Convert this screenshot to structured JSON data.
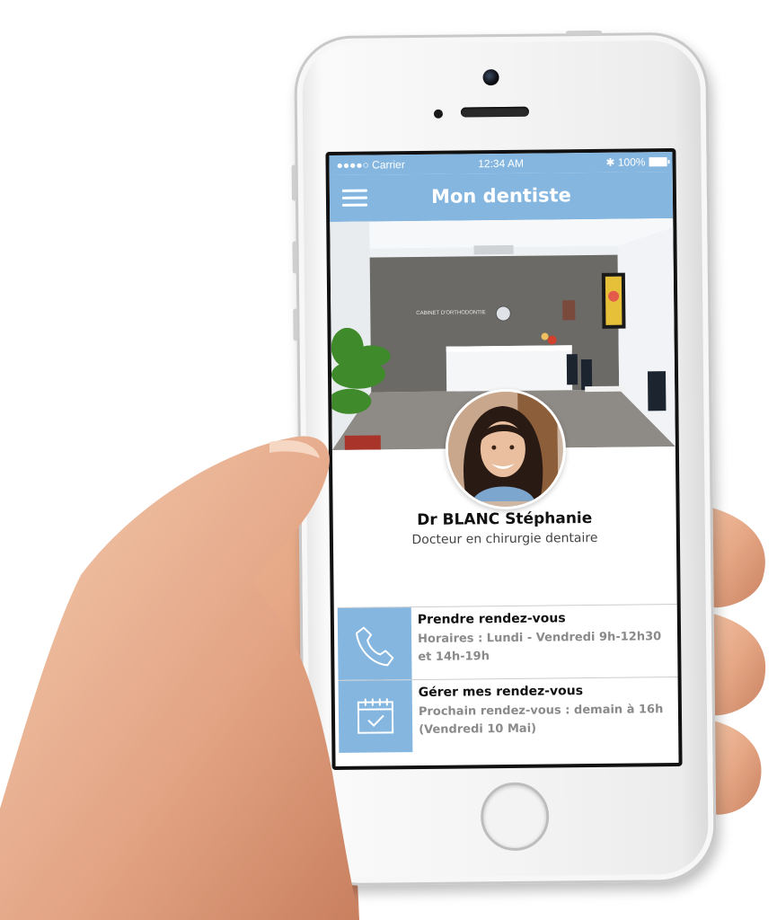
{
  "status_bar": {
    "carrier": "●●●●○ Carrier",
    "time": "12:34 AM",
    "battery": "✱ 100%"
  },
  "nav": {
    "title": "Mon dentiste",
    "menu_icon": "hamburger-menu-icon"
  },
  "hero": {
    "sign_text": "CABINET D'ORTHODONTIE"
  },
  "doctor": {
    "name": "Dr BLANC Stéphanie",
    "title": "Docteur en chirurgie dentaire"
  },
  "actions": [
    {
      "icon": "phone-icon",
      "title": "Prendre rendez-vous",
      "subtitle": "Horaires : Lundi - Vendredi 9h-12h30 et 14h-19h"
    },
    {
      "icon": "calendar-icon",
      "title": "Gérer mes rendez-vous",
      "subtitle": "Prochain rendez-vous : demain à 16h (Vendredi 10 Mai)"
    }
  ],
  "colors": {
    "accent": "#84b6e0",
    "text_dark": "#111111",
    "text_muted": "#8a8a8a"
  }
}
